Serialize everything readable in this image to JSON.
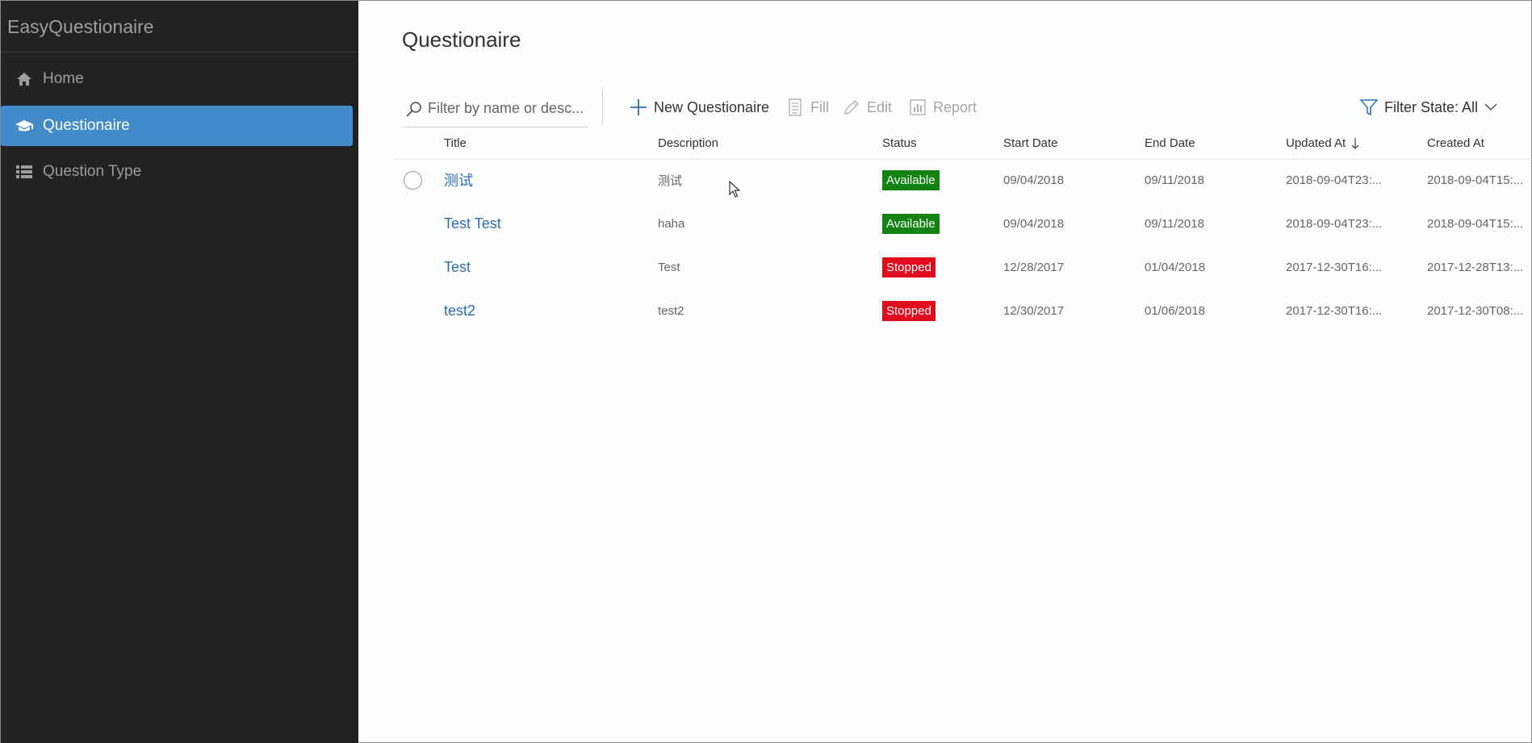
{
  "app": {
    "brand": "EasyQuestionaire"
  },
  "sidebar": {
    "items": [
      {
        "label": "Home",
        "icon": "home-icon",
        "active": false
      },
      {
        "label": "Questionaire",
        "icon": "graduation-cap-icon",
        "active": true
      },
      {
        "label": "Question Type",
        "icon": "list-icon",
        "active": false
      }
    ]
  },
  "main": {
    "title": "Questionaire",
    "search": {
      "placeholder": "Filter by name or desc..."
    },
    "commands": {
      "new": "New Questionaire",
      "fill": "Fill",
      "edit": "Edit",
      "report": "Report"
    },
    "filter": {
      "label": "Filter State: All"
    },
    "table": {
      "columns": [
        "Title",
        "Description",
        "Status",
        "Start Date",
        "End Date",
        "Updated At",
        "Created At"
      ],
      "sorted_column": "Updated At",
      "sort_direction": "descending",
      "rows": [
        {
          "title": "测试",
          "description": "测试",
          "status": "Available",
          "start": "09/04/2018",
          "end": "09/11/2018",
          "updated": "2018-09-04T23:...",
          "created": "2018-09-04T15:..."
        },
        {
          "title": "Test Test",
          "description": "haha",
          "status": "Available",
          "start": "09/04/2018",
          "end": "09/11/2018",
          "updated": "2018-09-04T23:...",
          "created": "2018-09-04T15:..."
        },
        {
          "title": "Test",
          "description": "Test",
          "status": "Stopped",
          "start": "12/28/2017",
          "end": "01/04/2018",
          "updated": "2017-12-30T16:...",
          "created": "2017-12-28T13:..."
        },
        {
          "title": "test2",
          "description": "test2",
          "status": "Stopped",
          "start": "12/30/2017",
          "end": "01/06/2018",
          "updated": "2017-12-30T16:...",
          "created": "2017-12-30T08:..."
        }
      ]
    }
  },
  "colors": {
    "sidebar_bg": "#222222",
    "active_nav": "#428bca",
    "link": "#2a6fb6",
    "available": "#138313",
    "stopped": "#e00b1c"
  }
}
